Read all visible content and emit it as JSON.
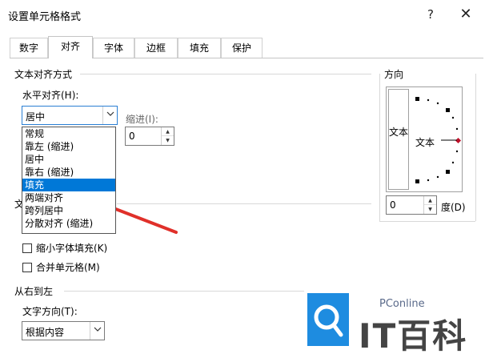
{
  "window": {
    "title": "设置单元格格式",
    "help_label": "?",
    "close_label": "✕"
  },
  "tabs": [
    {
      "label": "数字"
    },
    {
      "label": "对齐",
      "active": true
    },
    {
      "label": "字体"
    },
    {
      "label": "边框"
    },
    {
      "label": "填充"
    },
    {
      "label": "保护"
    }
  ],
  "text_alignment": {
    "section_title": "文本对齐方式",
    "horizontal_label": "水平对齐(H):",
    "horizontal_value": "居中",
    "indent_label": "缩进(I):",
    "indent_value": "0",
    "options": [
      "常规",
      "靠左 (缩进)",
      "居中",
      "靠右 (缩进)",
      "填充",
      "两端对齐",
      "跨列居中",
      "分散对齐 (缩进)"
    ],
    "selected_option": "填充"
  },
  "text_control": {
    "section_title_partial": "文",
    "shrink_label": "缩小字体填充(K)",
    "merge_label": "合并单元格(M)"
  },
  "rtl": {
    "section_title": "从右到左",
    "direction_label": "文字方向(T):",
    "direction_value": "根据内容"
  },
  "orientation": {
    "section_title": "方向",
    "vertical_text": "文本",
    "dial_text": "文本",
    "degrees_value": "0",
    "degrees_label": "度(D)"
  },
  "watermark": {
    "small": "PConline",
    "big": "IT百科"
  },
  "colors": {
    "accent": "#0078d7",
    "arrow": "#e0302a",
    "logo": "#1e8ce0"
  }
}
